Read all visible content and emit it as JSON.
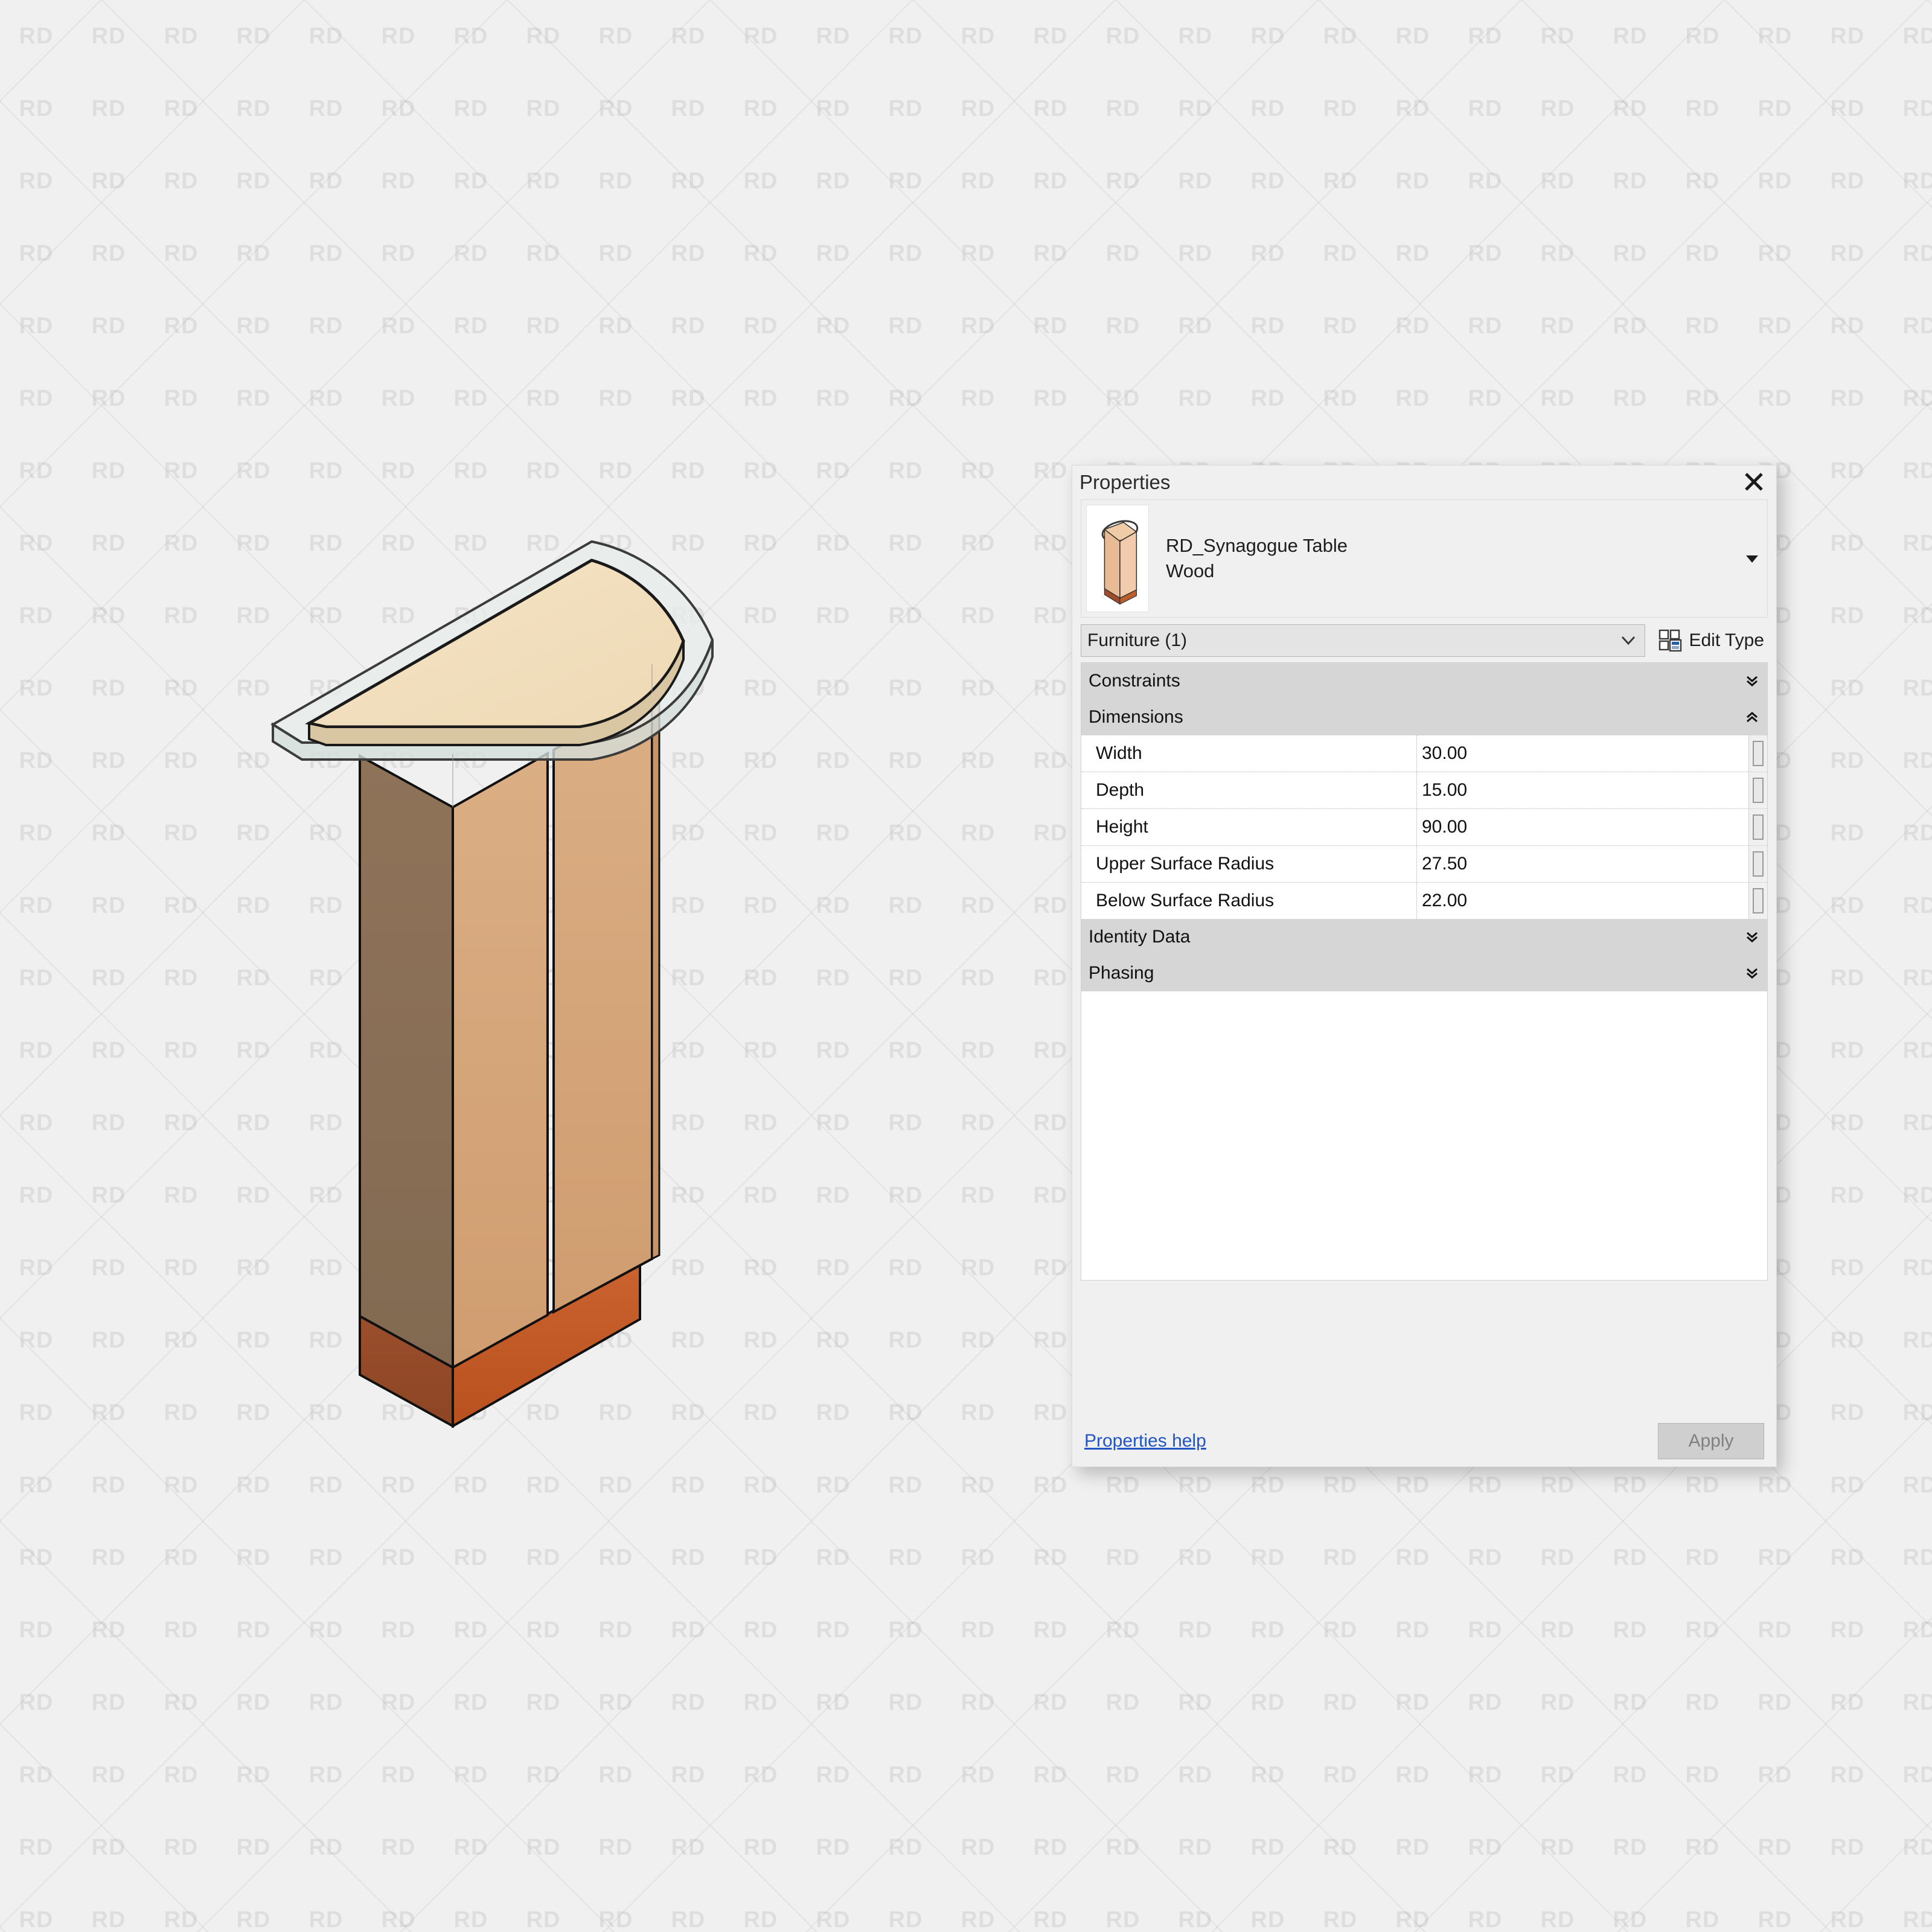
{
  "background": {
    "watermark_text": "RD",
    "bg_color": "#f0f0f0"
  },
  "model": {
    "name": "rd-synagogue-table-wood-3d-view",
    "description": "Semicircular top synagogue table in wood, axonometric view",
    "colors": {
      "top_surface": "#f2dfbe",
      "glass_overhang": "#dfe8e6",
      "front_face": "#d4a478",
      "side_face_shadow": "#8a6e54",
      "base_plinth": "#c0582a",
      "outline": "#1a1a1a"
    }
  },
  "dialog": {
    "title": "Properties",
    "close_label": "Close",
    "type_selector": {
      "family": "RD_Synagogue Table",
      "type": "Wood",
      "thumbnail_name": "element-preview-thumbnail"
    },
    "category_combo": {
      "value": "Furniture (1)",
      "options": [
        "Furniture (1)"
      ]
    },
    "edit_type_button": "Edit Type",
    "groups": [
      {
        "label": "Constraints",
        "collapsed": true,
        "rows": []
      },
      {
        "label": "Dimensions",
        "collapsed": false,
        "rows": [
          {
            "name": "Width",
            "value": "30.00"
          },
          {
            "name": "Depth",
            "value": "15.00"
          },
          {
            "name": "Height",
            "value": "90.00"
          },
          {
            "name": "Upper Surface Radius",
            "value": "27.50"
          },
          {
            "name": "Below Surface Radius",
            "value": "22.00"
          }
        ]
      },
      {
        "label": "Identity Data",
        "collapsed": true,
        "rows": []
      },
      {
        "label": "Phasing",
        "collapsed": true,
        "rows": []
      }
    ],
    "footer": {
      "help_link": "Properties help",
      "apply_button": "Apply"
    },
    "colors": {
      "panel_bg": "#f0f0f0",
      "group_header_bg": "#d6d6d6",
      "link": "#2154c4",
      "apply_disabled_text": "#808080"
    }
  }
}
